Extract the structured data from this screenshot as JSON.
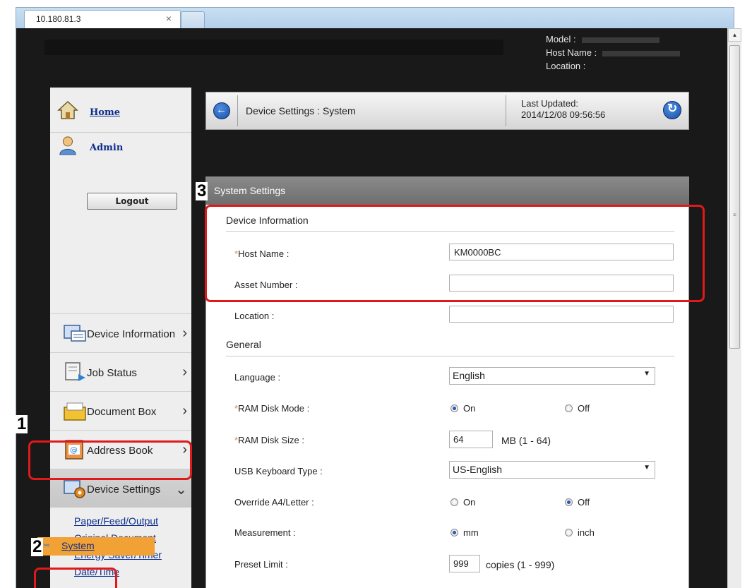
{
  "browser": {
    "tab_title": "10.180.81.3",
    "tab_close": "×"
  },
  "top_info": {
    "model_label": "Model :",
    "host_label": "Host Name :",
    "location_label": "Location :"
  },
  "sidebar": {
    "home": "Home",
    "admin": "Admin",
    "logout": "Logout",
    "menu": [
      {
        "label": "Device Information",
        "icon": "device-info-icon"
      },
      {
        "label": "Job Status",
        "icon": "job-status-icon"
      },
      {
        "label": "Document Box",
        "icon": "document-box-icon"
      },
      {
        "label": "Address Book",
        "icon": "address-book-icon"
      },
      {
        "label": "Device Settings",
        "icon": "device-settings-icon"
      }
    ],
    "submenu": [
      "Paper/Feed/Output",
      "Original Document",
      "Energy Saver/Timer",
      "Date/Time",
      "System"
    ]
  },
  "header": {
    "breadcrumb": "Device Settings : System",
    "last_updated_label": "Last Updated:",
    "last_updated_value": "2014/12/08 09:56:56"
  },
  "panel": {
    "title": "System Settings",
    "section_device": "Device Information",
    "host_name_label": "Host Name :",
    "host_name_value": "KM0000BC",
    "asset_label": "Asset Number :",
    "asset_value": "",
    "location_label": "Location :",
    "location_value": "",
    "section_general": "General",
    "language_label": "Language :",
    "language_value": "English",
    "ram_mode_label": "RAM Disk Mode :",
    "ram_mode_on": "On",
    "ram_mode_off": "Off",
    "ram_size_label": "RAM Disk Size :",
    "ram_size_value": "64",
    "ram_size_unit": "MB (1 - 64)",
    "usb_label": "USB Keyboard Type :",
    "usb_value": "US-English",
    "override_label": "Override A4/Letter :",
    "override_on": "On",
    "override_off": "Off",
    "measurement_label": "Measurement :",
    "measurement_mm": "mm",
    "measurement_inch": "inch",
    "preset_label": "Preset Limit :",
    "preset_value": "999",
    "preset_unit": "copies (1 - 999)",
    "required_mark": "*"
  },
  "annotations": {
    "step1": "1",
    "step2": "2",
    "step3": "3"
  },
  "colors": {
    "callout": "#e0191b",
    "active_sub": "#f2a134",
    "link": "#0d2d8c"
  }
}
